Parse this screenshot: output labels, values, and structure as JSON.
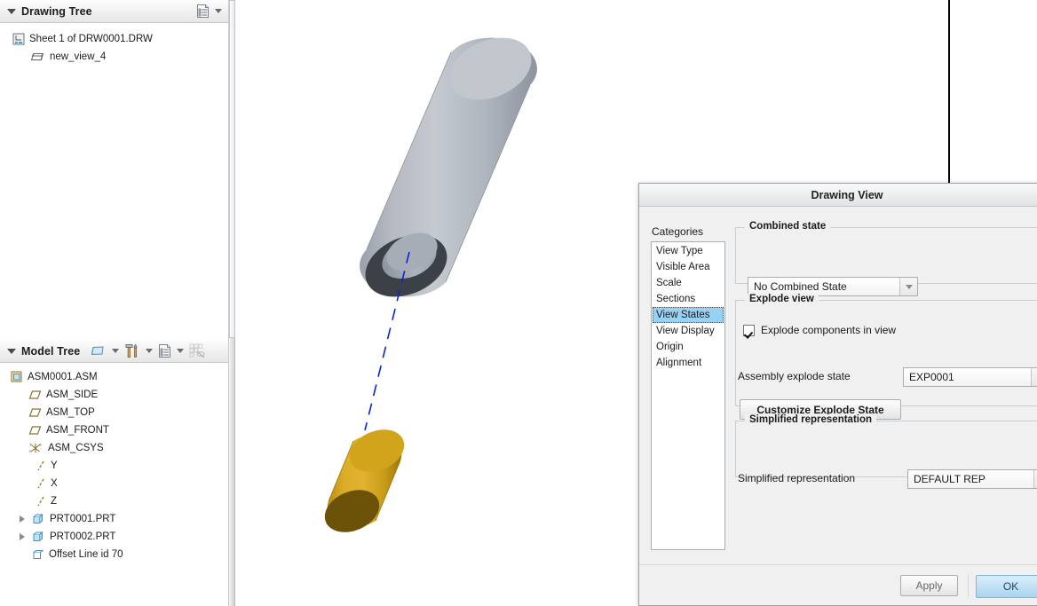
{
  "left_panel": {
    "drawing_tree": {
      "title": "Drawing Tree",
      "collapse_icon": "triangle-down-icon",
      "settings_icon": "tree-settings-icon",
      "dropdown_icon": "chevron-down-icon",
      "items": [
        {
          "label": "Sheet 1 of DRW0001.DRW",
          "icon": "sheet-icon",
          "depth": 0,
          "expandable": false
        },
        {
          "label": "new_view_4",
          "icon": "view-icon",
          "depth": 1,
          "expandable": false
        }
      ]
    },
    "model_tree": {
      "title": "Model Tree",
      "collapse_icon": "triangle-down-icon",
      "display_icon": "display-style-icon",
      "tools_icon": "tools-icon",
      "settings_icon": "tree-settings-icon",
      "filter_icon": "tree-filters-disabled-icon",
      "dropdown_icon": "chevron-down-icon",
      "items": [
        {
          "label": "ASM0001.ASM",
          "icon": "assembly-icon",
          "depth": 0,
          "expandable": false
        },
        {
          "label": "ASM_SIDE",
          "icon": "datum-plane-icon",
          "depth": 1,
          "expandable": false
        },
        {
          "label": "ASM_TOP",
          "icon": "datum-plane-icon",
          "depth": 1,
          "expandable": false
        },
        {
          "label": "ASM_FRONT",
          "icon": "datum-plane-icon",
          "depth": 1,
          "expandable": false
        },
        {
          "label": "ASM_CSYS",
          "icon": "csys-icon",
          "depth": 1,
          "expandable": false
        },
        {
          "label": "Y",
          "icon": "datum-axis-icon",
          "depth": 2,
          "expandable": false
        },
        {
          "label": "X",
          "icon": "datum-axis-icon",
          "depth": 2,
          "expandable": false
        },
        {
          "label": "Z",
          "icon": "datum-axis-icon",
          "depth": 2,
          "expandable": false
        },
        {
          "label": "PRT0001.PRT",
          "icon": "part-icon",
          "depth": 1,
          "expandable": true
        },
        {
          "label": "PRT0002.PRT",
          "icon": "part-icon",
          "depth": 1,
          "expandable": true
        },
        {
          "label": "Offset Line id 70",
          "icon": "offset-line-icon",
          "depth": 1,
          "expandable": false
        }
      ]
    }
  },
  "graphics": {
    "sheet_border_color": "#000000",
    "tube": {
      "name": "gray-tube-part",
      "body_color": "#aab0b9",
      "highlight_color": "#c7ccd3",
      "shadow_color": "#8f959f",
      "end_face_color": "#3c4148",
      "bore_color": "#9aa0a9"
    },
    "plug": {
      "name": "gold-plug-part",
      "body_color": "#d4a017",
      "highlight_color": "#e3b53a",
      "shadow_color": "#a37c0e",
      "end_face_color": "#6b5208"
    },
    "explode_line_color": "#0a23d8"
  },
  "dialog": {
    "title": "Drawing View",
    "categories_label": "Categories",
    "categories": [
      {
        "label": "View Type",
        "selected": false
      },
      {
        "label": "Visible Area",
        "selected": false
      },
      {
        "label": "Scale",
        "selected": false
      },
      {
        "label": "Sections",
        "selected": false
      },
      {
        "label": "View States",
        "selected": true
      },
      {
        "label": "View Display",
        "selected": false
      },
      {
        "label": "Origin",
        "selected": false
      },
      {
        "label": "Alignment",
        "selected": false
      }
    ],
    "combined_state": {
      "group_title": "Combined state",
      "value": "No Combined State",
      "dropdown_icon": "chevron-down-icon"
    },
    "explode_view": {
      "group_title": "Explode view",
      "checkbox_label": "Explode components in view",
      "checkbox_checked": true,
      "assembly_label": "Assembly explode state",
      "assembly_value": "EXP0001",
      "customize_button": "Customize Explode State",
      "dropdown_icon": "chevron-down-icon"
    },
    "simplified_rep": {
      "group_title": "Simplified representation",
      "field_label": "Simplified representation",
      "value": "DEFAULT REP",
      "dropdown_icon": "chevron-down-icon"
    },
    "footer": {
      "apply_label": "Apply",
      "ok_label": "OK",
      "ok_accent_color": "#a9d4f0"
    }
  }
}
